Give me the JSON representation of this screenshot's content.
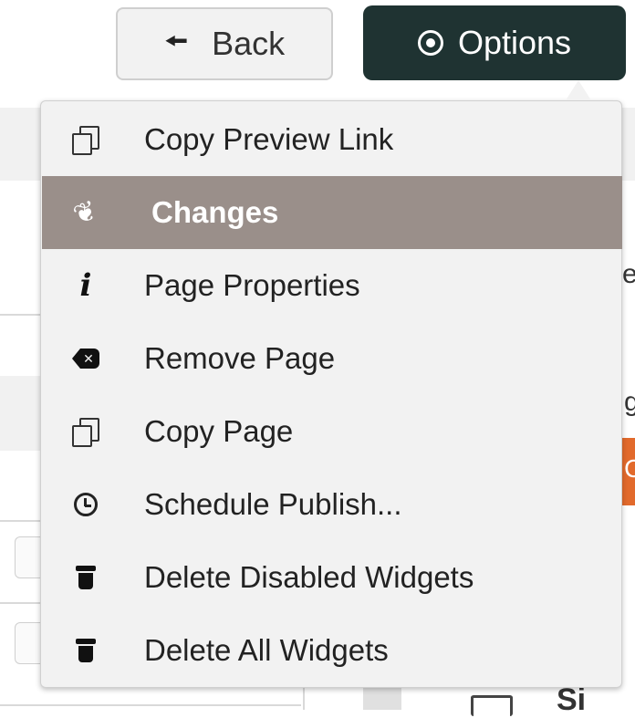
{
  "header": {
    "back_label": "Back",
    "back_icon": "arrow-left-icon",
    "options_label": "Options",
    "options_icon": "circle-dot-icon",
    "options_bg": "#1f3332"
  },
  "menu": {
    "active_bg": "#9a8f8a",
    "items": [
      {
        "label": "Copy Preview Link",
        "icon": "copy-icon"
      },
      {
        "label": "Changes",
        "icon": "feather-icon",
        "active": true
      },
      {
        "label": "Page Properties",
        "icon": "info-icon"
      },
      {
        "label": "Remove Page",
        "icon": "remove-icon"
      },
      {
        "label": "Copy Page",
        "icon": "copy-icon"
      },
      {
        "label": "Schedule Publish...",
        "icon": "clock-icon"
      },
      {
        "label": "Delete Disabled Widgets",
        "icon": "trash-icon"
      },
      {
        "label": "Delete All Widgets",
        "icon": "trash-icon"
      }
    ]
  },
  "background": {
    "frag_e": "e",
    "frag_g": "g",
    "frag_c": "C",
    "frag_si": "Si"
  }
}
